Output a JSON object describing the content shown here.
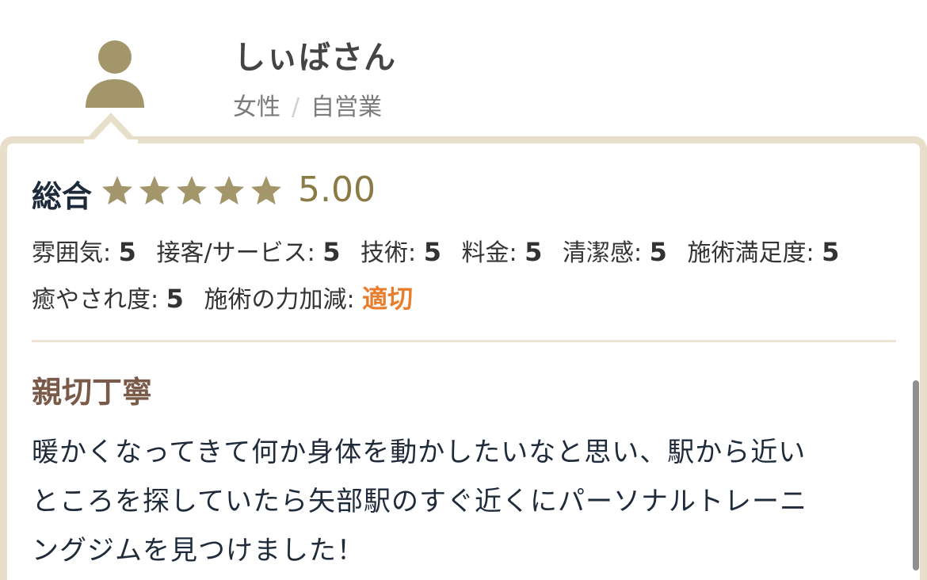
{
  "reviewer": {
    "name": "しぃばさん",
    "gender": "女性",
    "separator": "/",
    "occupation": "自営業"
  },
  "rating": {
    "overall_label": "総合",
    "stars": 5,
    "max_stars": 5,
    "overall_score": "5.00"
  },
  "criteria": [
    {
      "label": "雰囲気:",
      "value": "5"
    },
    {
      "label": "接客/サービス:",
      "value": "5"
    },
    {
      "label": "技術:",
      "value": "5"
    },
    {
      "label": "料金:",
      "value": "5"
    },
    {
      "label": "清潔感:",
      "value": "5"
    },
    {
      "label": "施術満足度:",
      "value": "5"
    },
    {
      "label": "癒やされ度:",
      "value": "5"
    },
    {
      "label": "施術の力加減:",
      "value": "適切"
    }
  ],
  "review": {
    "title": "親切丁寧",
    "body_lines": [
      "暖かくなってきて何か身体を動かしたいなと思い、駅から近い",
      "ところを探していたら矢部駅のすぐ近くにパーソナルトレーニ",
      "ングジムを見つけました！"
    ]
  },
  "colors": {
    "accent_gold": "#a3966b",
    "card_border": "#e8dfcb",
    "score_text": "#8a7a45",
    "title_brown": "#7a5a48",
    "highlight_orange": "#e87e2c"
  },
  "icons": {
    "avatar": "user-avatar-icon",
    "star": "star-icon"
  }
}
